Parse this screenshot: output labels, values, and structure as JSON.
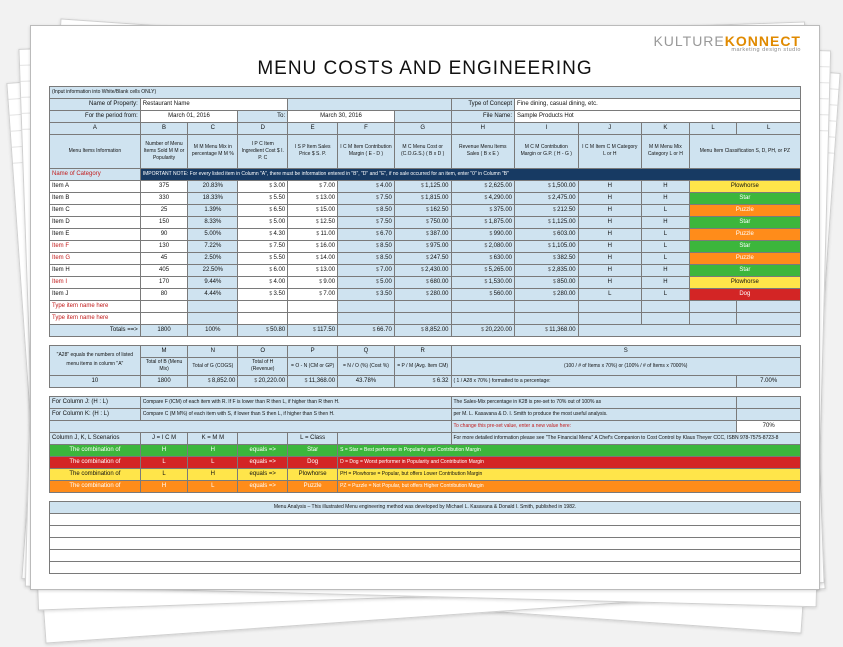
{
  "logo": {
    "line1a": "KULTURE",
    "line1b": "KONNECT",
    "line2": "marketing design studio"
  },
  "title": "MENU COSTS AND ENGINEERING",
  "intro": "(Input information into White/Blank cells ONLY)",
  "hdr": {
    "name_of_property": "Name of Property:",
    "restaurant": "Restaurant Name",
    "type_of_concept": "Type of Concept",
    "concept": "Fine dining, casual dining, etc.",
    "for_period": "For the period from:",
    "from": "March 01, 2016",
    "to_lbl": "To:",
    "to": "March 30, 2016",
    "file_name_lbl": "File Name:",
    "file_name": "Sample Products Hot"
  },
  "letters": [
    "A",
    "B",
    "C",
    "D",
    "E",
    "F",
    "G",
    "H",
    "I",
    "J",
    "K",
    "L"
  ],
  "heads": {
    "a": "Menu Items Information",
    "b": "Number of Menu Items Sold\nM M or Popularity",
    "c": "M M\nMenu Mix\nin percentage\nM M %",
    "d": "I P C  Item\nIngredient\nCost $\nI. P. C",
    "e": "I S P\nItem Sales\nPrice $\nS. P.",
    "f": "I C M\nItem Contribution\nMargin\n( E - D )",
    "g": "M C\nMenu Cost\nor (C.O.G.S.)\n( B x D )",
    "h": "Revenue\nMenu Items\nSales\n( B x E )",
    "i": "M C M\nContribution\nMargin or G.P.\n( H - G )",
    "j": "I C M\nItem C M\nCategory\nL or H",
    "k": "M M\nMenu Mix\nCategory\nL or H",
    "l": "Menu\nItem\nClassification\nS, D, PH, or PZ"
  },
  "name_of_cat": "Name of Category",
  "navy_note": "IMPORTANT NOTE: For every listed item in Column \"A\", there must be information entered in \"B\", \"D\" and \"E\", if no sale occurred for an item, enter \"0\" in Column \"B\"",
  "items": [
    {
      "name": "Item A",
      "b": "375",
      "c": "20.83%",
      "d": "3.00",
      "e": "7.00",
      "f": "4.00",
      "g": "1,125.00",
      "h": "2,625.00",
      "i": "1,500.00",
      "j": "H",
      "k": "H",
      "cls": "Plowhorse",
      "clsClass": "yellow"
    },
    {
      "name": "Item B",
      "b": "330",
      "c": "18.33%",
      "d": "5.50",
      "e": "13.00",
      "f": "7.50",
      "g": "1,815.00",
      "h": "4,290.00",
      "i": "2,475.00",
      "j": "H",
      "k": "H",
      "cls": "Star",
      "clsClass": "green"
    },
    {
      "name": "Item C",
      "b": "25",
      "c": "1.39%",
      "d": "6.50",
      "e": "15.00",
      "f": "8.50",
      "g": "162.50",
      "h": "375.00",
      "i": "212.50",
      "j": "H",
      "k": "L",
      "cls": "Puzzle",
      "clsClass": "orange"
    },
    {
      "name": "Item D",
      "b": "150",
      "c": "8.33%",
      "d": "5.00",
      "e": "12.50",
      "f": "7.50",
      "g": "750.00",
      "h": "1,875.00",
      "i": "1,125.00",
      "j": "H",
      "k": "H",
      "cls": "Star",
      "clsClass": "green"
    },
    {
      "name": "Item E",
      "b": "90",
      "c": "5.00%",
      "d": "4.30",
      "e": "11.00",
      "f": "6.70",
      "g": "387.00",
      "h": "990.00",
      "i": "603.00",
      "j": "H",
      "k": "L",
      "cls": "Puzzle",
      "clsClass": "orange"
    },
    {
      "name": "Item F",
      "red": true,
      "b": "130",
      "c": "7.22%",
      "d": "7.50",
      "e": "16.00",
      "f": "8.50",
      "g": "975.00",
      "h": "2,080.00",
      "i": "1,105.00",
      "j": "H",
      "k": "L",
      "cls": "Star",
      "clsClass": "green"
    },
    {
      "name": "Item G",
      "red": true,
      "b": "45",
      "c": "2.50%",
      "d": "5.50",
      "e": "14.00",
      "f": "8.50",
      "g": "247.50",
      "h": "630.00",
      "i": "382.50",
      "j": "H",
      "k": "L",
      "cls": "Puzzle",
      "clsClass": "orange"
    },
    {
      "name": "Item H",
      "b": "405",
      "c": "22.50%",
      "d": "6.00",
      "e": "13.00",
      "f": "7.00",
      "g": "2,430.00",
      "h": "5,265.00",
      "i": "2,835.00",
      "j": "H",
      "k": "H",
      "cls": "Star",
      "clsClass": "green"
    },
    {
      "name": "Item I",
      "red": true,
      "b": "170",
      "c": "9.44%",
      "d": "4.00",
      "e": "9.00",
      "f": "5.00",
      "g": "680.00",
      "h": "1,530.00",
      "i": "850.00",
      "j": "H",
      "k": "H",
      "cls": "Plowhorse",
      "clsClass": "yellow"
    },
    {
      "name": "Item J",
      "b": "80",
      "c": "4.44%",
      "d": "3.50",
      "e": "7.00",
      "f": "3.50",
      "g": "280.00",
      "h": "560.00",
      "i": "280.00",
      "j": "L",
      "k": "L",
      "cls": "Dog",
      "clsClass": "red"
    },
    {
      "name": "Type item name here",
      "red": true
    },
    {
      "name": "Type item name here",
      "red": true
    }
  ],
  "totals": {
    "label": "Totals ==>",
    "b": "1800",
    "c": "100%",
    "d": "50.80",
    "e": "117.50",
    "f": "66.70",
    "g": "8,852.00",
    "h": "20,220.00",
    "i": "11,368.00"
  },
  "row2hdr": {
    "note": "\"A28\" equals the numbers of listed menu items in column \"A\"",
    "m": "M",
    "n": "N",
    "o": "O",
    "p": "P",
    "q": "Q",
    "r": "R",
    "s": "S",
    "mlbl": "Total of B\n(Menu Mix)",
    "nlbl": "Total of G\n(COGS)",
    "olbl": "Total of H\n(Revenue)",
    "plbl": "= O - N\n(CM or GP)",
    "qlbl": "= N / O (%)\n(Cost %)",
    "rlbl": "= P / M\n(Avg. Item CM)",
    "slbl": "(100 / # of Items x 70%)  or  (100% / # of Items x 7000%)"
  },
  "row2val": {
    "a": "10",
    "m": "1800",
    "n": "8,852.00",
    "o": "20,220.00",
    "p": "11,368.00",
    "q": "43.78%",
    "r": "6.32",
    "s": "( 1 / A28  x  70% )  formatted to a percentage:",
    "spct": "7.00%"
  },
  "colJnote": {
    "lbl": "For Column J: (H : L)",
    "txt": "Compare  F (ICM) of each item with  R.  If F is lower than R then L,  if higher than R then  H."
  },
  "colKnote": {
    "lbl": "For Column K: (H : L)",
    "txt": "Compare C (M M%) of each item with S,  if lower than S then L, if higher than S then H."
  },
  "salesmix": {
    "a": "The Sales-Mix percentage in K28 is pre-set to 70% out of 100% as",
    "b": "per M. L. Kasavana & D. I. Smith to produce the most useful analysis.",
    "c": "To change this pre-set value, enter a new value here:",
    "cval": "70%",
    "d": "For more detailed information please see \"The Financial Menu\" A Chef's Companion to Cost Control by Klaus Theyer CCC, ISBN 978-7575-8723-8"
  },
  "scen": {
    "hdr": "Column J, K, L  Scenarios",
    "j": "J = I C M",
    "k": "K = M M",
    "arrow": "",
    "l": "L = Class",
    "r1": {
      "t": "The combination of",
      "j": "H",
      "k": "H",
      "eq": "equals =>",
      "cls": "Star",
      "desc": "S = Star = Best performer in Popularity and Contribution Margin"
    },
    "r2": {
      "t": "The combination of",
      "j": "L",
      "k": "L",
      "eq": "equals =>",
      "cls": "Dog",
      "desc": "D = Dog = Worst performer in Popularity and Contribution Margin"
    },
    "r3": {
      "t": "The combination of",
      "j": "L",
      "k": "H",
      "eq": "equals =>",
      "cls": "Plowhorse",
      "desc": "PH = Plowhorse = Popular, but offers Lower Contribution Margin"
    },
    "r4": {
      "t": "The combination of",
      "j": "H",
      "k": "L",
      "eq": "equals =>",
      "cls": "Puzzle",
      "desc": "PZ = Puzzle = Not Popular, but offers Higher Contribution Margin"
    }
  },
  "footnote": "Menu Analysis – This illustrated Menu engineering method was developed by Michael L. Kasavana & Donald I. Smith, published in 1982."
}
